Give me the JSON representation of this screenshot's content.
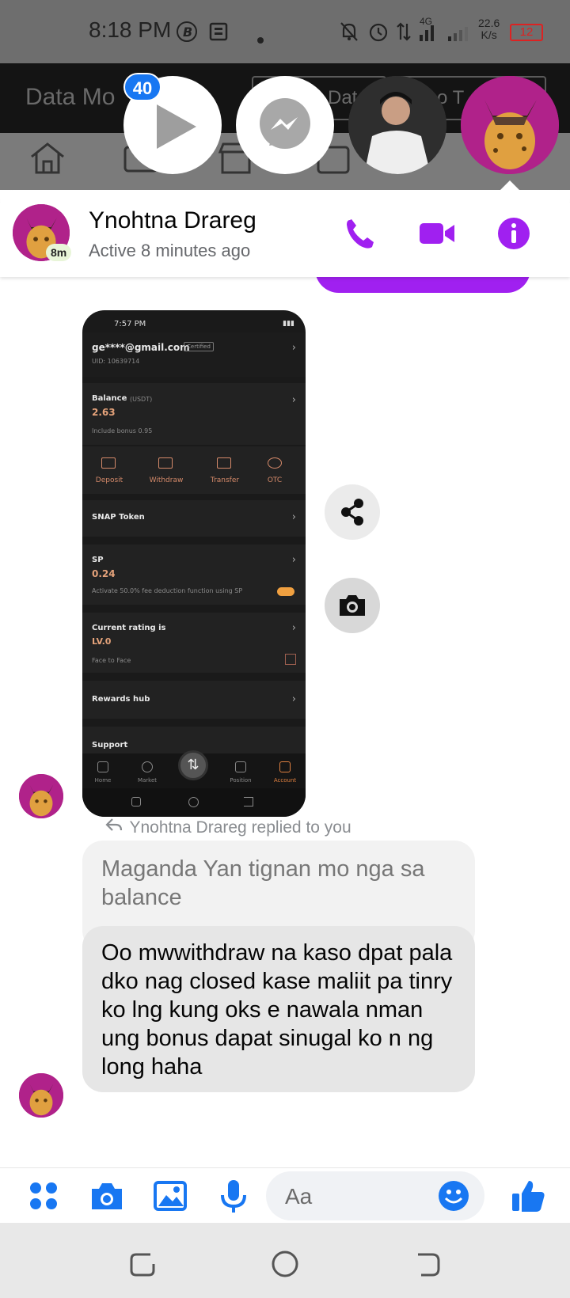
{
  "status_bar": {
    "time": "8:18 PM",
    "network_type": "4G",
    "speed": "22.6",
    "speed_unit": "K/s",
    "battery": "12"
  },
  "background_app": {
    "title": "Data Mo",
    "button_left": "Dat",
    "button_right": "o T"
  },
  "chat_heads": {
    "badge_count": "40",
    "heads": [
      "play-app-head",
      "messenger-head",
      "contact-photo-head",
      "leopard-avatar-head"
    ]
  },
  "header": {
    "name": "Ynohtna Drareg",
    "status": "Active 8 minutes ago",
    "active_tag": "8m",
    "accent_color": "#a020f0"
  },
  "shared_screenshot": {
    "time": "7:57 PM",
    "email": "ge****@gmail.com",
    "certified": "Certified",
    "uid": "UID: 10639714",
    "balance_label": "Balance",
    "balance_unit": "(USDT)",
    "balance_value": "2.63",
    "bonus_note": "Include bonus 0.95",
    "actions": [
      "Deposit",
      "Withdraw",
      "Transfer",
      "OTC"
    ],
    "snap_token": "SNAP Token",
    "sp_label": "SP",
    "sp_value": "0.24",
    "sp_note": "Activate 50.0% fee deduction function using SP",
    "rating_label": "Current rating is",
    "rating_value": "LV.0",
    "rating_note": "Face to Face",
    "rewards_hub": "Rewards hub",
    "support": "Support",
    "tabs": [
      "Home",
      "Market",
      "Position",
      "Account"
    ]
  },
  "messages": {
    "replied_label": "Ynohtna Drareg replied to you",
    "quoted_text": "Maganda Yan tignan mo nga sa balance",
    "reply_text": "Oo mwwithdraw na kaso dpat pala dko nag closed kase maliit pa tinry ko lng kung oks e nawala nman ung bonus dapat sinugal ko n ng long haha"
  },
  "composer": {
    "placeholder": "Aa",
    "icon_color": "#1877f2"
  }
}
